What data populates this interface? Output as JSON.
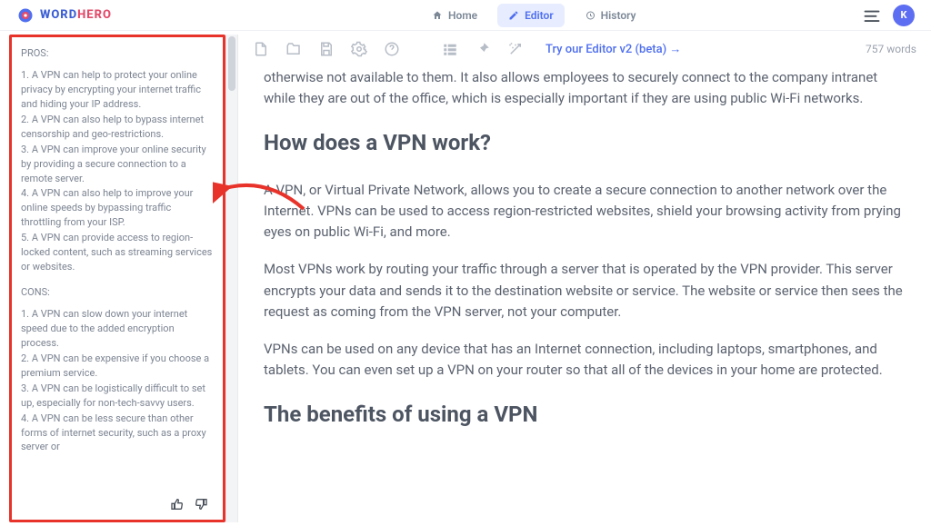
{
  "brand": {
    "word": "WORD",
    "hero": "HERO"
  },
  "nav": {
    "home": "Home",
    "editor": "Editor",
    "history": "History"
  },
  "avatar_initial": "K",
  "sidebar": {
    "pros_title": "PROS:",
    "pros": [
      "A VPN can help to protect your online privacy by encrypting your internet traffic and hiding your IP address.",
      "A VPN can also help to bypass internet censorship and geo-restrictions.",
      "A VPN can improve your online security by providing a secure connection to a remote server.",
      "A VPN can also help to improve your online speeds by bypassing traffic throttling from your ISP.",
      "A VPN can provide access to region-locked content, such as streaming services or websites."
    ],
    "cons_title": "CONS:",
    "cons": [
      "A VPN can slow down your internet speed due to the added encryption process.",
      "A VPN can be expensive if you choose a premium service.",
      "A VPN can be logistically difficult to set up, especially for non-tech-savvy users.",
      "A VPN can be less secure than other forms of internet security, such as a proxy server or"
    ]
  },
  "toolbar": {
    "try_link": "Try our Editor v2 (beta) →",
    "word_count": "757 words"
  },
  "article": {
    "intro_continued": "otherwise not available to them. It also allows employees to securely connect to the company intranet while they are out of the office, which is especially important if they are using public Wi-Fi networks.",
    "h2_how": "How does a VPN work?",
    "p1": "A VPN, or Virtual Private Network, allows you to create a secure connection to another network over the Internet. VPNs can be used to access region-restricted websites, shield your browsing activity from prying eyes on public Wi-Fi, and more.",
    "p2": "Most VPNs work by routing your traffic through a server that is operated by the VPN provider. This server encrypts your data and sends it to the destination website or service. The website or service then sees the request as coming from the VPN server, not your computer.",
    "p3": "VPNs can be used on any device that has an Internet connection, including laptops, smartphones, and tablets. You can even set up a VPN on your router so that all of the devices in your home are protected.",
    "h2_benefits": "The benefits of using a VPN"
  }
}
